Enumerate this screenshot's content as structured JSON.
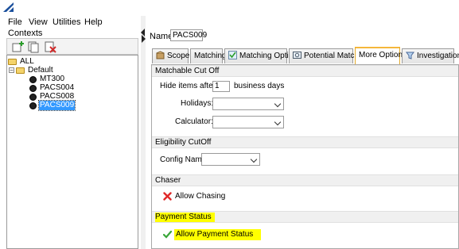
{
  "menu": [
    "File",
    "View",
    "Utilities",
    "Help"
  ],
  "left": {
    "contexts_label": "Contexts",
    "tree": {
      "root": "ALL",
      "group": "Default",
      "items": [
        "MT300",
        "PACS004",
        "PACS008",
        "PACS009"
      ],
      "selected": "PACS009"
    }
  },
  "name": {
    "label": "Name:",
    "value": "PACS009"
  },
  "tabs": [
    "Scope",
    "Matching",
    "Matching Options",
    "Potential Match",
    "More Options",
    "Investigation"
  ],
  "active_tab": "More Options",
  "sections": {
    "matchable": {
      "title": "Matchable Cut Off",
      "hide_label": "Hide items after:",
      "hide_value": "1",
      "hide_unit": "business days",
      "holidays_label": "Holidays:",
      "holidays_value": "",
      "calculator_label": "Calculator:",
      "calculator_value": ""
    },
    "eligibility": {
      "title": "Eligibility CutOff",
      "config_label": "Config Name:",
      "config_value": ""
    },
    "chaser": {
      "title": "Chaser",
      "allow_chasing": "Allow Chasing"
    },
    "payment": {
      "title": "Payment Status",
      "allow_payment": "Allow Payment Status"
    }
  },
  "colors": {
    "selection": "#3399ff",
    "highlight": "#ffff00",
    "active_tab_border": "#f5b73b"
  }
}
